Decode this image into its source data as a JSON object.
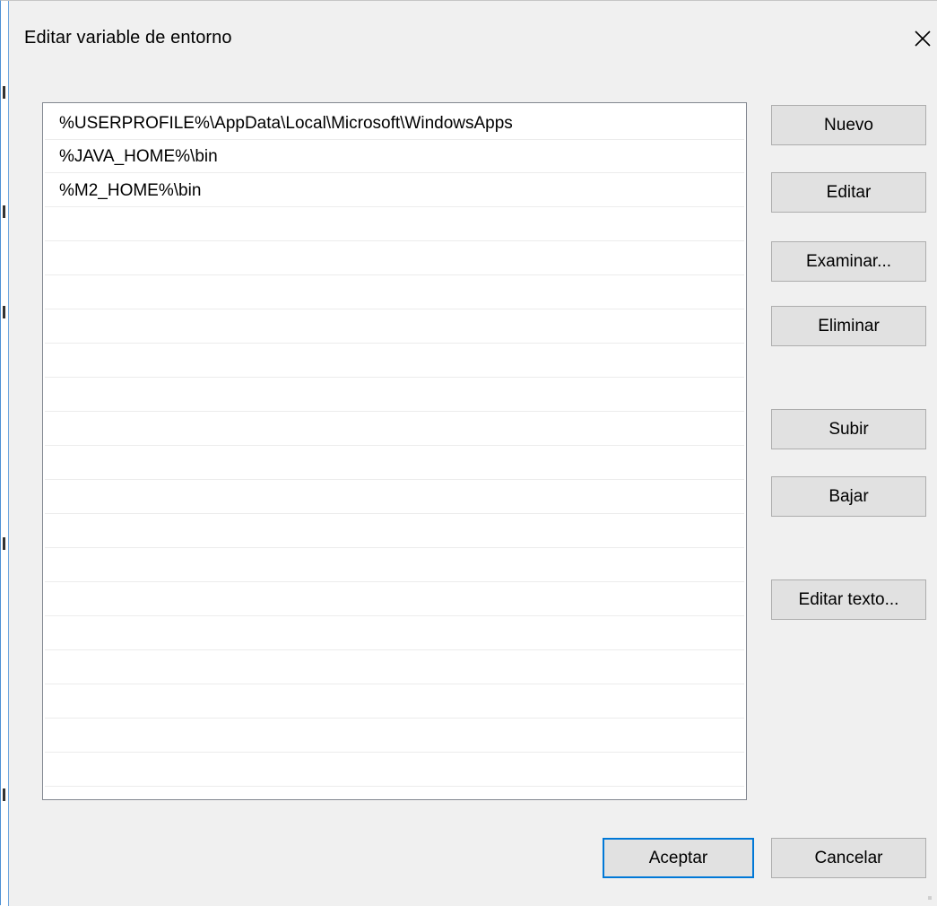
{
  "window": {
    "title": "Editar variable de entorno",
    "close_icon": "close-icon"
  },
  "list": {
    "items": [
      "%USERPROFILE%\\AppData\\Local\\Microsoft\\WindowsApps",
      "%JAVA_HOME%\\bin",
      "%M2_HOME%\\bin"
    ]
  },
  "buttons": {
    "nuevo": "Nuevo",
    "editar": "Editar",
    "examinar": "Examinar...",
    "eliminar": "Eliminar",
    "subir": "Subir",
    "bajar": "Bajar",
    "editar_texto": "Editar texto...",
    "aceptar": "Aceptar",
    "cancelar": "Cancelar"
  },
  "colors": {
    "accent": "#0078d7",
    "button_face": "#e1e1e1",
    "dialog_bg": "#f0f0f0"
  }
}
